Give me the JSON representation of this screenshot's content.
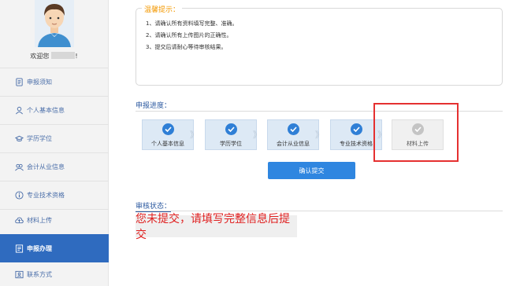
{
  "sidebar": {
    "welcome": "欢迎您",
    "welcome_suffix": "!",
    "items": [
      {
        "label": "申报须知",
        "icon": "document-icon"
      },
      {
        "label": "个人基本信息",
        "icon": "user-icon"
      },
      {
        "label": "学历学位",
        "icon": "graduation-cap-icon"
      },
      {
        "label": "会计从业信息",
        "icon": "group-icon"
      },
      {
        "label": "专业技术资格",
        "icon": "info-icon"
      },
      {
        "label": "材料上传",
        "icon": "cloud-upload-icon"
      },
      {
        "label": "申报办理",
        "icon": "form-icon",
        "active": true
      },
      {
        "label": "联系方式",
        "icon": "contact-card-icon"
      }
    ]
  },
  "notice": {
    "title": "温馨提示：",
    "lines": [
      "1、请确认所有资料填写完整、准确。",
      "2、请确认所有上传图片的正确性。",
      "3、提交后请耐心等待审核结果。"
    ]
  },
  "progress": {
    "title": "申报进度：",
    "steps": [
      {
        "label": "个人基本信息",
        "done": true
      },
      {
        "label": "学历学位",
        "done": true
      },
      {
        "label": "会计从业信息",
        "done": true
      },
      {
        "label": "专业技术资格",
        "done": true
      },
      {
        "label": "材料上传",
        "done": false
      }
    ],
    "separator": "》"
  },
  "submit_label": "确认提交",
  "status": {
    "title": "审核状态：",
    "message": "您未提交，请填写完整信息后提交"
  },
  "colors": {
    "nav_text": "#4a6ea9",
    "nav_active_bg": "#2f6bbf",
    "step_done_bg": "#dde9f5",
    "step_check": "#2f7fd6",
    "notice_title": "#f39800",
    "status_text": "#e02020",
    "highlight_border": "#e53030",
    "button": "#2f86e0"
  }
}
